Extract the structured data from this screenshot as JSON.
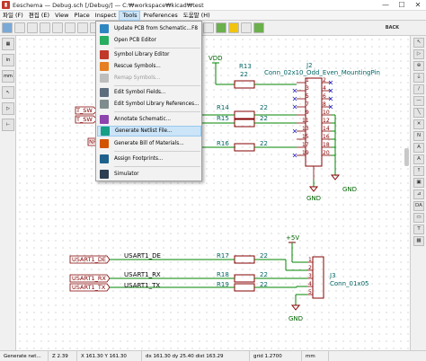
{
  "window": {
    "title": "Eeschema — Debug.sch [/Debug/] — C:₩workspace₩kicad₩test",
    "minimize": "—",
    "maximize": "☐",
    "close": "✕"
  },
  "menubar": {
    "items": [
      "파일 (F)",
      "편집 (E)",
      "View",
      "Place",
      "Inspect",
      "Tools",
      "Preferences",
      "도움말 (H)"
    ]
  },
  "toolbar": {
    "back_label": "BACK"
  },
  "lefttoolbar": {
    "buttons": [
      "▦",
      "in",
      "mm",
      "↖",
      "▷",
      "⊢"
    ]
  },
  "righttoolbar": {
    "buttons": [
      "↖",
      "▷",
      "⊕",
      "⏚",
      "/",
      "—",
      "╲",
      "✕",
      "N",
      "A",
      "A",
      "↑",
      "▣",
      "⊿",
      "DA",
      "▭",
      "T",
      "▦"
    ]
  },
  "tools_menu": {
    "items": [
      {
        "label": "Update PCB from Schematic...",
        "shortcut": "F8",
        "enabled": true,
        "icon": "update-pcb-icon",
        "color": "#2e86c1"
      },
      {
        "label": "Open PCB Editor",
        "shortcut": "",
        "enabled": true,
        "icon": "pcb-editor-icon",
        "color": "#27ae60"
      },
      {
        "label": "Symbol Library Editor",
        "shortcut": "",
        "enabled": true,
        "icon": "symbol-editor-icon",
        "color": "#c0392b"
      },
      {
        "label": "Rescue Symbols...",
        "shortcut": "",
        "enabled": true,
        "icon": "rescue-icon",
        "color": "#e67e22"
      },
      {
        "label": "Remap Symbols...",
        "shortcut": "",
        "enabled": false,
        "icon": "remap-icon",
        "color": "#bdbdbd"
      },
      {
        "label": "Edit Symbol Fields...",
        "shortcut": "",
        "enabled": true,
        "icon": "edit-fields-icon",
        "color": "#5d6d7e"
      },
      {
        "label": "Edit Symbol Library References...",
        "shortcut": "",
        "enabled": true,
        "icon": "lib-refs-icon",
        "color": "#7f8c8d"
      },
      {
        "label": "Annotate Schematic...",
        "shortcut": "",
        "enabled": true,
        "icon": "annotate-icon",
        "color": "#8e44ad"
      },
      {
        "label": "Generate Netlist File...",
        "shortcut": "",
        "enabled": true,
        "icon": "netlist-icon",
        "color": "#16a085"
      },
      {
        "label": "Generate Bill of Materials...",
        "shortcut": "",
        "enabled": true,
        "icon": "bom-icon",
        "color": "#d35400"
      },
      {
        "label": "Assign Footprints...",
        "shortcut": "",
        "enabled": true,
        "icon": "footprint-icon",
        "color": "#1f618d"
      },
      {
        "label": "Simulator",
        "shortcut": "",
        "enabled": true,
        "icon": "simulator-icon",
        "color": "#2c3e50"
      }
    ],
    "highlighted_index": 8
  },
  "schematic": {
    "power": {
      "vdd": "VDD",
      "plus5v": "+5V",
      "gnd1": "GND",
      "gnd2": "GND",
      "gnd3": "GND"
    },
    "j2": {
      "ref": "J2",
      "value": "Conn_02x10_Odd_Even_MountingPin",
      "left_pins": [
        "1",
        "3",
        "5",
        "7",
        "9",
        "11",
        "13",
        "15",
        "17",
        "19"
      ],
      "right_pins": [
        "2",
        "4",
        "6",
        "8",
        "10",
        "12",
        "14",
        "16",
        "18",
        "20"
      ]
    },
    "j3": {
      "ref": "J3",
      "value": "Conn_01x05",
      "pins": [
        "1",
        "2",
        "3",
        "4",
        "5"
      ]
    },
    "resistors": [
      {
        "ref": "R13",
        "value": "22"
      },
      {
        "ref": "R14",
        "value": "22"
      },
      {
        "ref": "R15",
        "value": "22"
      },
      {
        "ref": "R16",
        "value": "22"
      },
      {
        "ref": "R17",
        "value": "22"
      },
      {
        "ref": "R18",
        "value": "22"
      },
      {
        "ref": "R19",
        "value": "22"
      }
    ],
    "global_labels": [
      "T_SW",
      "T_SW",
      "NR",
      "USART1_DE",
      "USART1_RX",
      "USART1_TX"
    ],
    "net_labels": [
      "USART1_DE",
      "USART1_RX",
      "USART1_TX"
    ]
  },
  "statusbar": {
    "cells": [
      "Generate net...",
      "Z 2.39",
      "X 161.30  Y 161.30",
      "dx 161.30  dy 25.40  dist 163.29",
      "grid 1.2700",
      "mm"
    ]
  }
}
